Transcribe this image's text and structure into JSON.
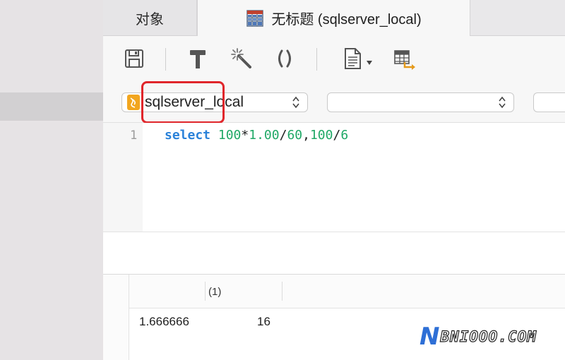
{
  "tabs": {
    "objects_label": "对象",
    "query_label": "无标题 (sqlserver_local)"
  },
  "toolbar": {
    "icons": [
      "save-icon",
      "format-hammer-icon",
      "magic-wand-icon",
      "parentheses-icon",
      "document-menu-icon",
      "table-export-icon"
    ]
  },
  "connection": {
    "selected": "sqlserver_local",
    "database": "",
    "schema": ""
  },
  "editor": {
    "line_number": "1",
    "tokens": {
      "keyword": "select",
      "n1": "100",
      "op1": "*",
      "n2": "1.00",
      "op2": "/",
      "n3": "60",
      "op3": ",",
      "n4": "100",
      "op4": "/",
      "n5": "6"
    }
  },
  "results": {
    "columns": [
      "",
      "(1)"
    ],
    "rows": [
      [
        "1.666666",
        "16"
      ]
    ]
  },
  "watermark": {
    "n": "N",
    "text": "BNIOOO.COM"
  },
  "colors": {
    "highlight": "#e0262b",
    "keyword": "#2b82d9",
    "number": "#1fa866"
  }
}
